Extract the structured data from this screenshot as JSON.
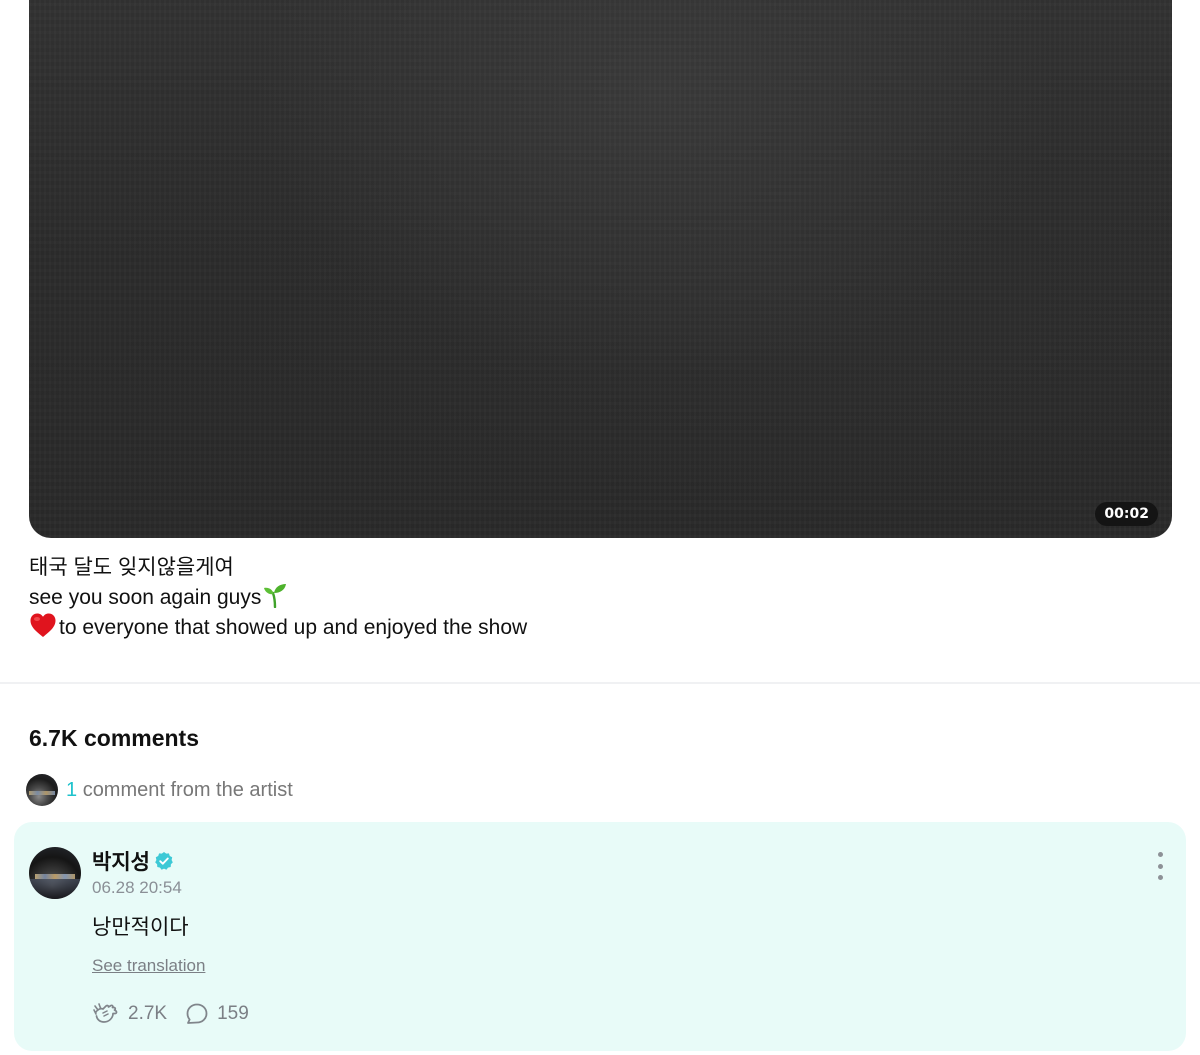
{
  "video": {
    "duration": "00:02"
  },
  "caption": {
    "line1": "태국 달도 잊지않을게여",
    "line2": "see you soon again guys",
    "line3": "to everyone that showed up and enjoyed the show"
  },
  "comments": {
    "count_label": "6.7K comments",
    "artist_count": "1",
    "artist_label": "comment from the artist"
  },
  "comment": {
    "author": "박지성",
    "timestamp": "06.28 20:54",
    "text": "낭만적이다",
    "translate_label": "See translation",
    "likes": "2.7K",
    "replies": "159"
  },
  "colors": {
    "accent": "#1ec2cc",
    "card_bg": "#e8fbf8",
    "verified": "#3dc9d6"
  },
  "icons": {
    "duration": "video-duration-badge",
    "sprout": "seedling-emoji",
    "heart": "red-heart-emoji",
    "verified": "verified-badge-icon",
    "like": "cheer-hands-icon",
    "reply": "speech-bubble-icon",
    "more": "more-vertical-icon"
  }
}
